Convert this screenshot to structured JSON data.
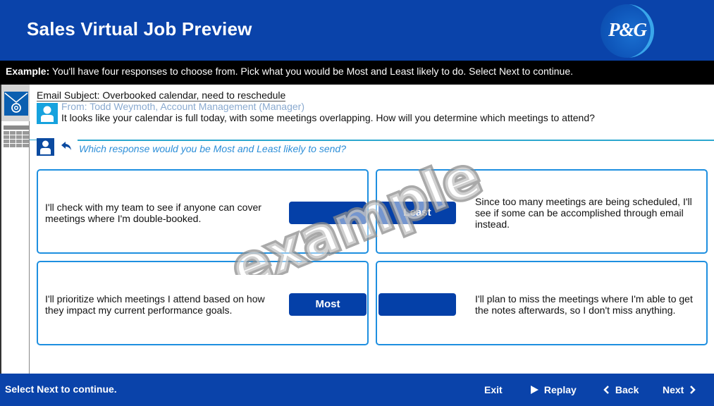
{
  "header": {
    "title": "Sales Virtual Job Preview",
    "logo_text": "P&G",
    "brand_color": "#0a43aa"
  },
  "instruction": {
    "label": "Example:",
    "text": " You'll have four responses to choose from. Pick what you would be Most and Least likely to do. Select Next to continue."
  },
  "sidebar": {
    "items": [
      {
        "icon": "email-icon",
        "active": true
      },
      {
        "icon": "calendar-icon",
        "active": false
      }
    ]
  },
  "email": {
    "subject": "Email Subject: Overbooked calendar, need to reschedule",
    "from": "From: Todd Weymoth, Account Management (Manager)",
    "body": "It looks like your calendar is full today, with some meetings overlapping. How will you determine which meetings to attend?"
  },
  "reply": {
    "question": "Which response would you be Most and Least likely to send?"
  },
  "options": [
    {
      "text": "I'll check with my team to see if anyone can cover meetings where I'm double-booked.",
      "selection": ""
    },
    {
      "text": "Since too many meetings are being scheduled, I'll see if some can be accomplished through email instead.",
      "selection": "Least"
    },
    {
      "text": "I'll prioritize which meetings I attend based on how they impact my current performance goals.",
      "selection": "Most"
    },
    {
      "text": "I'll plan to miss the meetings where I'm able to get the notes afterwards, so I don't miss anything.",
      "selection": ""
    }
  ],
  "watermark": "example",
  "footer": {
    "status": "Select Next to continue.",
    "exit_label": "Exit",
    "replay_label": "Replay",
    "back_label": "Back",
    "next_label": "Next"
  }
}
